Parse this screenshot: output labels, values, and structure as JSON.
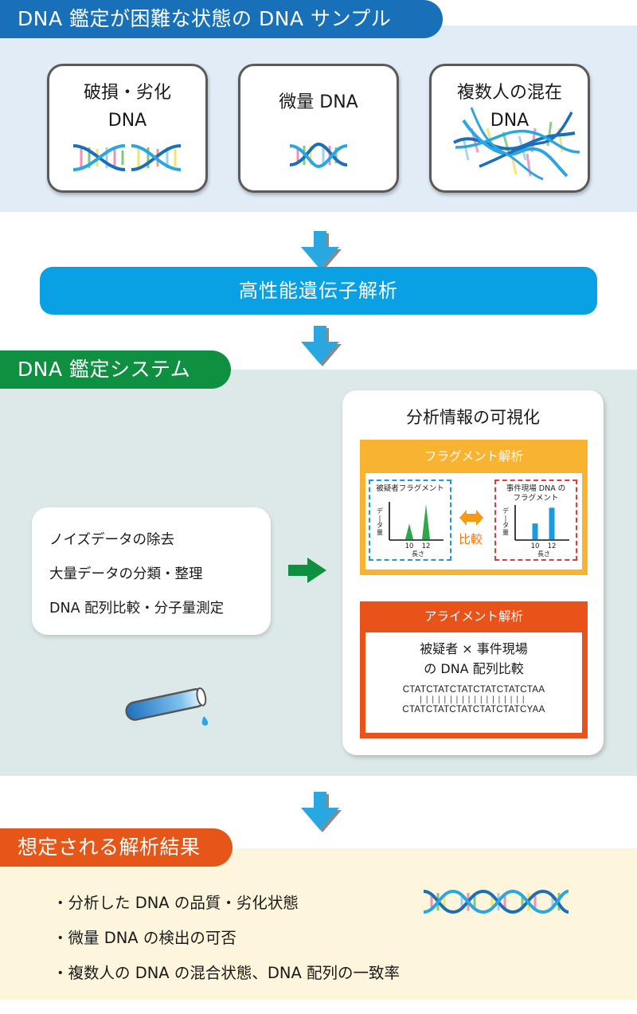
{
  "colors": {
    "section1_header": "#1770b8",
    "section1_bg": "#e1ecf7",
    "banner": "#0aa0e4",
    "section2_header": "#0e9040",
    "section2_bg": "#dde9e9",
    "section3_header": "#e65618",
    "section3_bg": "#fdf6dd",
    "fragment": "#f8b330",
    "alignment": "#e9531a",
    "arrow_blue": "#29a7e1",
    "arrow_green": "#0e9040"
  },
  "section1": {
    "title": "DNA 鑑定が困難な状態の DNA サンプル",
    "samples": [
      {
        "label_line1": "破損・劣化",
        "label_line2": "DNA",
        "icon": "broken-dna-icon"
      },
      {
        "label_line1": "微量 DNA",
        "label_line2": "",
        "icon": "small-dna-icon"
      },
      {
        "label_line1": "複数人の混在",
        "label_line2": "DNA",
        "icon": "mixed-dna-icon"
      }
    ]
  },
  "banner": {
    "label": "高性能遺伝子解析"
  },
  "section2": {
    "title": "DNA 鑑定システム",
    "process_items": [
      "ノイズデータの除去",
      "大量データの分類・整理",
      "DNA 配列比較・分子量測定"
    ],
    "visualization": {
      "title": "分析情報の可視化",
      "fragment": {
        "title": "フラグメント解析",
        "compare_label": "比較",
        "suspect_panel": {
          "title": "被疑者フラグメント",
          "ylabel": "データ量",
          "xlabel": "長さ",
          "x_ticks": [
            "10",
            "12"
          ]
        },
        "scene_panel": {
          "title_line1": "事件現場 DNA の",
          "title_line2": "フラグメント",
          "ylabel": "データ量",
          "xlabel": "長さ",
          "x_ticks": [
            "10",
            "12"
          ]
        }
      },
      "alignment": {
        "title": "アライメント解析",
        "desc_line1": "被疑者 × 事件現場",
        "desc_line2": "の DNA 配列比較",
        "seq_top": "CTATCTATCTATCTATCTATCTAA",
        "match_bars": "||||||||||||||||||",
        "seq_bottom": "CTATCTATCTATCTATCTATCYAA"
      }
    }
  },
  "section3": {
    "title": "想定される解析結果",
    "results": [
      "・分析した DNA の品質・劣化状態",
      "・微量 DNA の検出の可否",
      "・複数人の DNA の混合状態、DNA 配列の一致率"
    ]
  },
  "chart_data": [
    {
      "type": "bar",
      "title": "被疑者フラグメント",
      "xlabel": "長さ",
      "ylabel": "データ量",
      "categories": [
        "10",
        "12"
      ],
      "values": [
        0.45,
        1.0
      ],
      "mark": "peak"
    },
    {
      "type": "bar",
      "title": "事件現場 DNA のフラグメント",
      "xlabel": "長さ",
      "ylabel": "データ量",
      "categories": [
        "10",
        "12"
      ],
      "values": [
        0.45,
        0.9
      ],
      "mark": "bar"
    }
  ]
}
